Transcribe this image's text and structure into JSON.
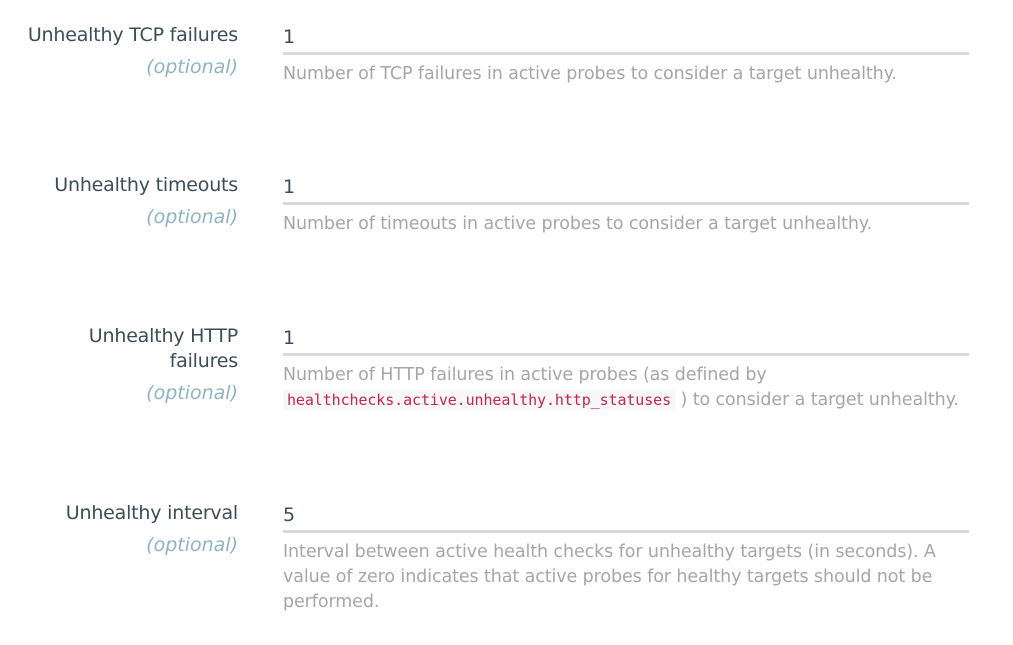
{
  "fields": [
    {
      "label": "Unhealthy TCP failures",
      "optional": "(optional)",
      "value": "1",
      "help": "Number of TCP failures in active probes to consider a target unhealthy."
    },
    {
      "label": "Unhealthy timeouts",
      "optional": "(optional)",
      "value": "1",
      "help": "Number of timeouts in active probes to consider a target unhealthy."
    },
    {
      "label": "Unhealthy HTTP failures",
      "optional": "(optional)",
      "value": "1",
      "help_before": "Number of HTTP failures in active probes (as defined by",
      "help_code": "healthchecks.active.unhealthy.http_statuses",
      "help_after": ") to consider a target unhealthy."
    },
    {
      "label": "Unhealthy interval",
      "optional": "(optional)",
      "value": "5",
      "help": "Interval between active health checks for unhealthy targets (in seconds). A value of zero indicates that active probes for healthy targets should not be performed."
    }
  ]
}
